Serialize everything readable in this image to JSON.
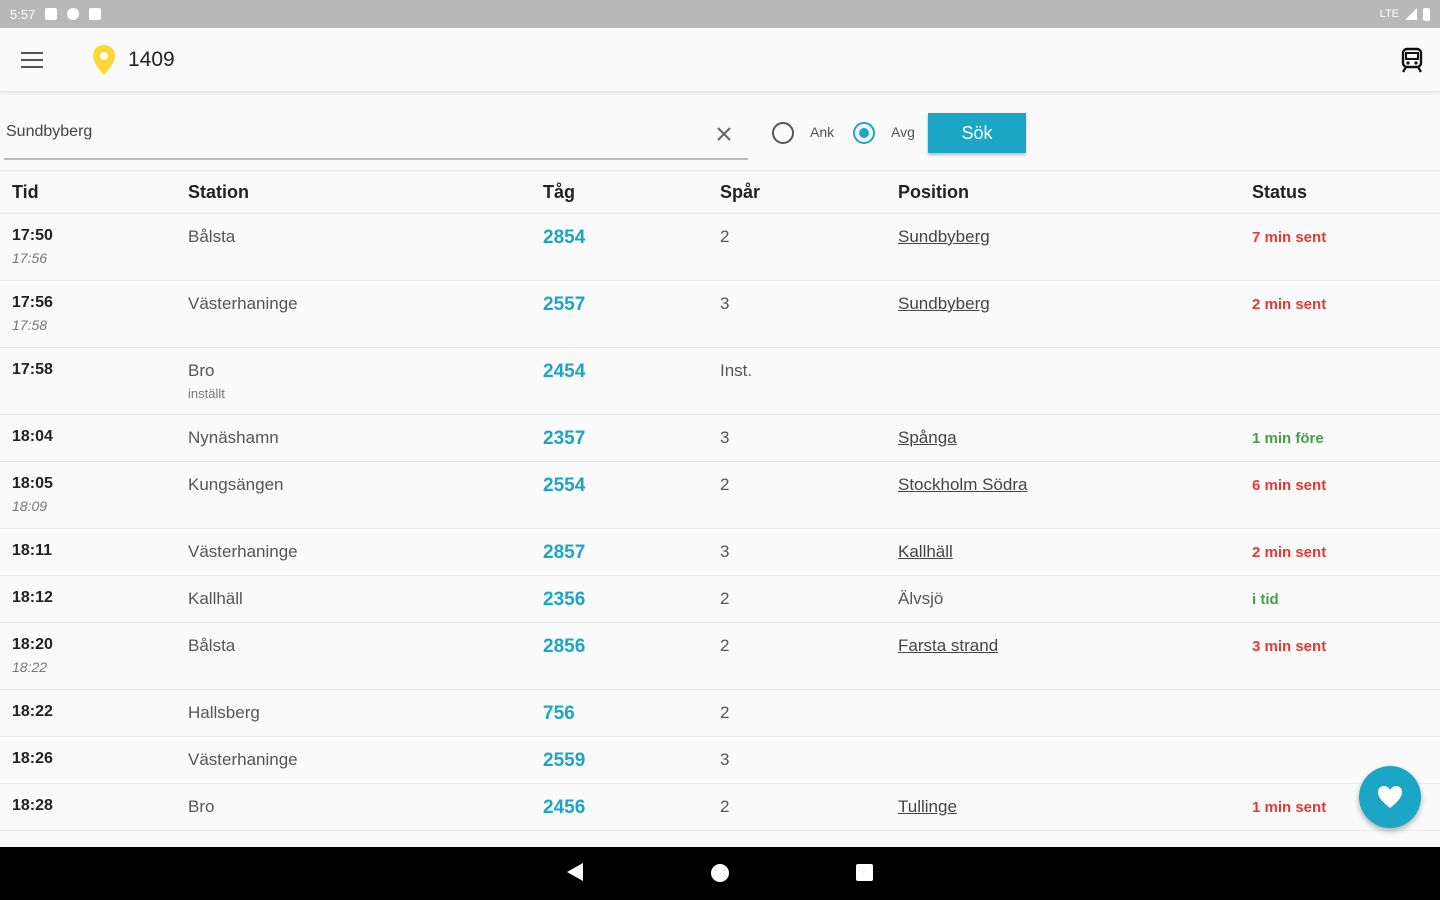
{
  "status_bar": {
    "time": "5:57",
    "network": "LTE"
  },
  "header": {
    "title": "1409"
  },
  "search": {
    "value": "Sundbyberg",
    "arrival_label": "Ank",
    "departure_label": "Avg",
    "selected": "Avg",
    "button_label": "Sök"
  },
  "table": {
    "headers": {
      "tid": "Tid",
      "station": "Station",
      "tag": "Tåg",
      "spar": "Spår",
      "position": "Position",
      "status": "Status"
    },
    "rows": [
      {
        "tid": "17:50",
        "tid_new": "17:56",
        "station": "Bålsta",
        "station_note": "",
        "tag": "2854",
        "spar": "2",
        "position": "Sundbyberg",
        "position_link": true,
        "status": "7 min sent",
        "status_type": "late"
      },
      {
        "tid": "17:56",
        "tid_new": "17:58",
        "station": "Västerhaninge",
        "station_note": "",
        "tag": "2557",
        "spar": "3",
        "position": "Sundbyberg",
        "position_link": true,
        "status": "2 min sent",
        "status_type": "late"
      },
      {
        "tid": "17:58",
        "tid_new": "",
        "station": "Bro",
        "station_note": "inställt",
        "tag": "2454",
        "spar": "Inst.",
        "position": "",
        "position_link": false,
        "status": "",
        "status_type": ""
      },
      {
        "tid": "18:04",
        "tid_new": "",
        "station": "Nynäshamn",
        "station_note": "",
        "tag": "2357",
        "spar": "3",
        "position": "Spånga",
        "position_link": true,
        "status": "1 min före",
        "status_type": "early"
      },
      {
        "tid": "18:05",
        "tid_new": "18:09",
        "station": "Kungsängen",
        "station_note": "",
        "tag": "2554",
        "spar": "2",
        "position": "Stockholm Södra",
        "position_link": true,
        "status": "6 min sent",
        "status_type": "late"
      },
      {
        "tid": "18:11",
        "tid_new": "",
        "station": "Västerhaninge",
        "station_note": "",
        "tag": "2857",
        "spar": "3",
        "position": "Kallhäll",
        "position_link": true,
        "status": "2 min sent",
        "status_type": "late"
      },
      {
        "tid": "18:12",
        "tid_new": "",
        "station": "Kallhäll",
        "station_note": "",
        "tag": "2356",
        "spar": "2",
        "position": "Älvsjö",
        "position_link": false,
        "status": "i tid",
        "status_type": "early"
      },
      {
        "tid": "18:20",
        "tid_new": "18:22",
        "station": "Bålsta",
        "station_note": "",
        "tag": "2856",
        "spar": "2",
        "position": "Farsta strand",
        "position_link": true,
        "status": "3 min sent",
        "status_type": "late"
      },
      {
        "tid": "18:22",
        "tid_new": "",
        "station": "Hallsberg",
        "station_note": "",
        "tag": "756",
        "spar": "2",
        "position": "",
        "position_link": false,
        "status": "",
        "status_type": ""
      },
      {
        "tid": "18:26",
        "tid_new": "",
        "station": "Västerhaninge",
        "station_note": "",
        "tag": "2559",
        "spar": "3",
        "position": "",
        "position_link": false,
        "status": "",
        "status_type": ""
      },
      {
        "tid": "18:28",
        "tid_new": "",
        "station": "Bro",
        "station_note": "",
        "tag": "2456",
        "spar": "2",
        "position": "Tullinge",
        "position_link": true,
        "status": "1 min sent",
        "status_type": "late"
      }
    ]
  },
  "icons": {
    "menu": "hamburger-icon",
    "location": "location-pin-icon",
    "train": "train-icon",
    "clear": "close-icon",
    "favorite": "heart-icon"
  },
  "colors": {
    "accent": "#1aa6c4",
    "late": "#e53935",
    "on_time": "#43a047",
    "pin": "#fdd835"
  }
}
